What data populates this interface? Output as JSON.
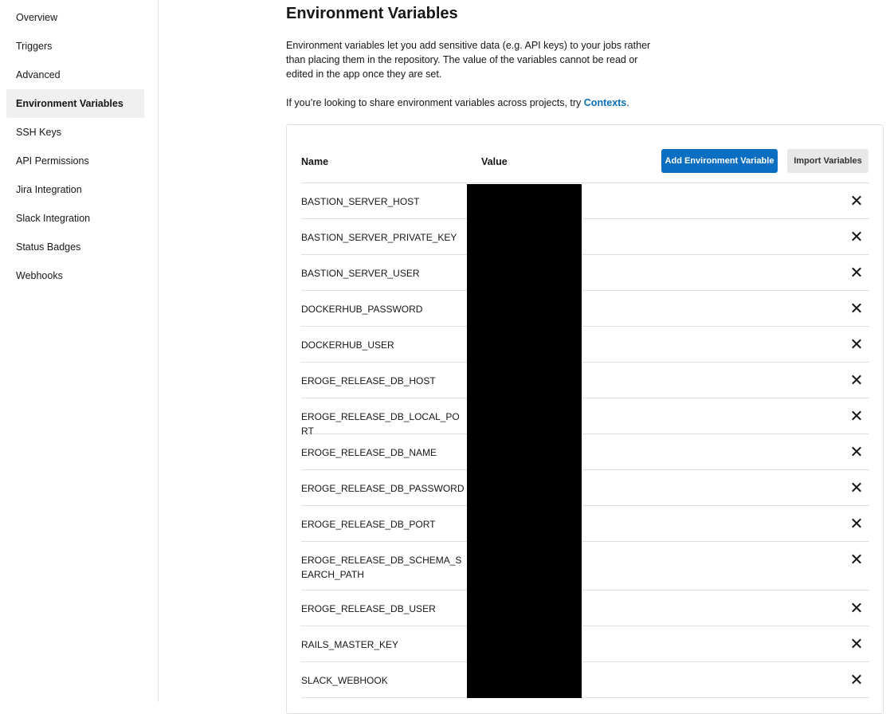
{
  "sidebar": {
    "items": [
      {
        "label": "Overview",
        "active": false
      },
      {
        "label": "Triggers",
        "active": false
      },
      {
        "label": "Advanced",
        "active": false
      },
      {
        "label": "Environment Variables",
        "active": true
      },
      {
        "label": "SSH Keys",
        "active": false
      },
      {
        "label": "API Permissions",
        "active": false
      },
      {
        "label": "Jira Integration",
        "active": false
      },
      {
        "label": "Slack Integration",
        "active": false
      },
      {
        "label": "Status Badges",
        "active": false
      },
      {
        "label": "Webhooks",
        "active": false
      }
    ]
  },
  "main": {
    "title": "Environment Variables",
    "description": "Environment variables let you add sensitive data (e.g. API keys) to your jobs rather than placing them in the repository. The value of the variables cannot be read or edited in the app once they are set.",
    "share_prefix": "If you’re looking to share environment variables across projects, try ",
    "share_link": "Contexts",
    "share_suffix": "."
  },
  "table": {
    "headers": {
      "name": "Name",
      "value": "Value"
    },
    "add_button": "Add Environment Variable",
    "import_button": "Import Variables",
    "delete_icon": "close-icon",
    "rows": [
      {
        "name": "BASTION_SERVER_HOST"
      },
      {
        "name": "BASTION_SERVER_PRIVATE_KEY"
      },
      {
        "name": "BASTION_SERVER_USER"
      },
      {
        "name": "DOCKERHUB_PASSWORD"
      },
      {
        "name": "DOCKERHUB_USER"
      },
      {
        "name": "EROGE_RELEASE_DB_HOST"
      },
      {
        "name": "EROGE_RELEASE_DB_LOCAL_PORT"
      },
      {
        "name": "EROGE_RELEASE_DB_NAME"
      },
      {
        "name": "EROGE_RELEASE_DB_PASSWORD"
      },
      {
        "name": "EROGE_RELEASE_DB_PORT"
      },
      {
        "name": "EROGE_RELEASE_DB_SCHEMA_SEARCH_PATH"
      },
      {
        "name": "EROGE_RELEASE_DB_USER"
      },
      {
        "name": "RAILS_MASTER_KEY"
      },
      {
        "name": "SLACK_WEBHOOK"
      }
    ]
  },
  "colors": {
    "accent": "#0a6fc2",
    "link": "#0a6fb8",
    "active_bg": "#f0f0f0",
    "border": "#e0e0e0"
  }
}
